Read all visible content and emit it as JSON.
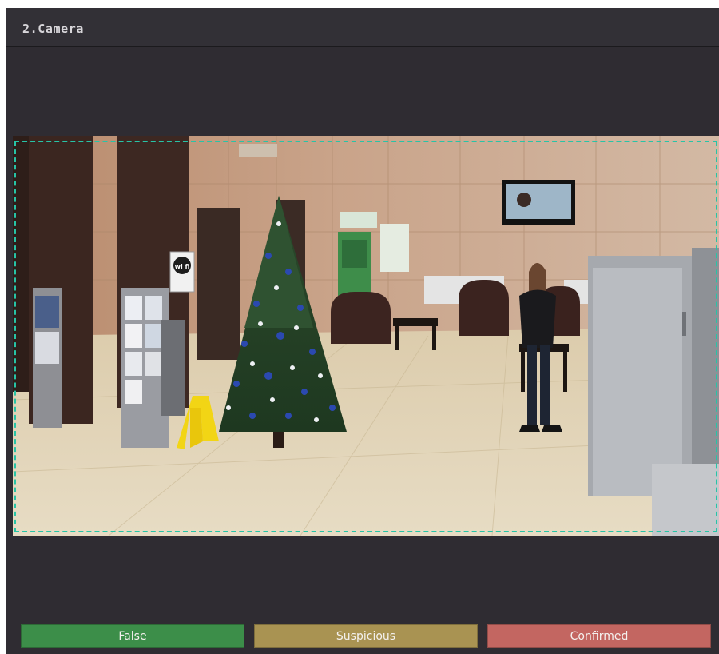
{
  "camera": {
    "title": "2.Camera"
  },
  "scene": {
    "wifi_sign": "wi fi"
  },
  "actions": {
    "false_label": "False",
    "suspicious_label": "Suspicious",
    "confirmed_label": "Confirmed"
  },
  "colors": {
    "false": "#3c8e49",
    "suspicious": "#a99352",
    "confirmed": "#c36661",
    "detection_box": "#27c4a7"
  }
}
